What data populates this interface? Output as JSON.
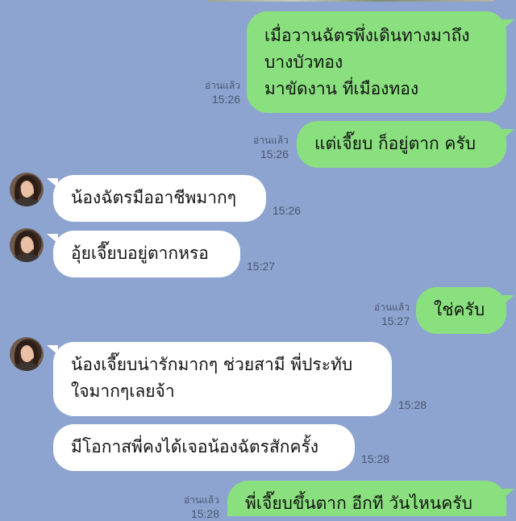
{
  "messages": [
    {
      "direction": "out",
      "lines": [
        "เมื่อวานฉัตรพึ่งเดินทางมาถึง",
        "บางบัวทอง",
        "มาขัดงาน ที่เมืองทอง"
      ],
      "read": "อ่านแล้ว",
      "time": "15:26"
    },
    {
      "direction": "out",
      "lines": [
        "แต่เจี๊ยบ ก็อยู่ตาก ครับ"
      ],
      "read": "อ่านแล้ว",
      "time": "15:26"
    },
    {
      "direction": "in",
      "lines": [
        "น้องฉัตรมืออาชีพมากๆ"
      ],
      "time": "15:26"
    },
    {
      "direction": "in",
      "lines": [
        "อุ้ยเจี๊ยบอยู่ตากหรอ"
      ],
      "time": "15:27"
    },
    {
      "direction": "out",
      "lines": [
        "ใช่ครับ"
      ],
      "read": "อ่านแล้ว",
      "time": "15:27"
    },
    {
      "direction": "in",
      "lines": [
        "น้องเจี๊ยบน่ารักมากๆ ช่วยสามี พี่ประทับ",
        "ใจมากๆเลยจ้า"
      ],
      "time": "15:28"
    },
    {
      "direction": "in",
      "lines": [
        "มีโอกาสพี่คงได้เจอน้องฉัตรสักครั้ง"
      ],
      "time": "15:28"
    },
    {
      "direction": "out",
      "lines": [
        "พี่เจี๊ยบขึ้นตาก อีกที วันไหนครับ"
      ],
      "read": "อ่านแล้ว",
      "time": "15:28"
    }
  ],
  "colors": {
    "background": "#8da4d0",
    "outgoing_bubble": "#8ae07f",
    "incoming_bubble": "#ffffff"
  }
}
